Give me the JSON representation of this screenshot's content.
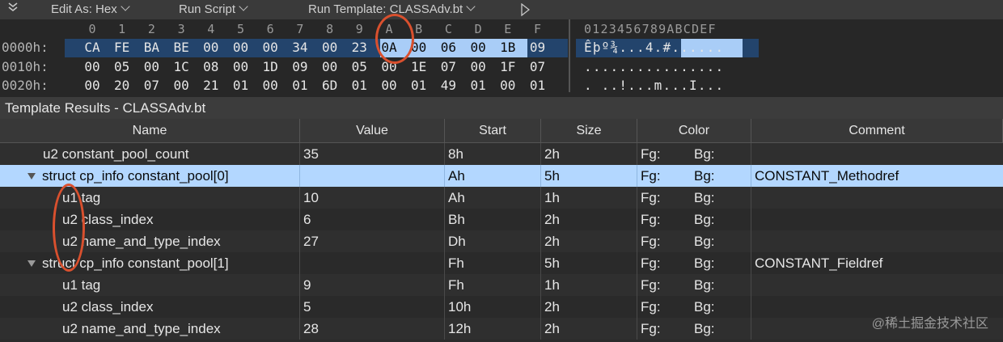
{
  "toolbar": {
    "items": [
      "Edit As: Hex",
      "Run Script",
      "Run Template: CLASSAdv.bt"
    ]
  },
  "hex": {
    "columns": [
      "0",
      "1",
      "2",
      "3",
      "4",
      "5",
      "6",
      "7",
      "8",
      "9",
      "A",
      "B",
      "C",
      "D",
      "E",
      "F"
    ],
    "ascii_header": "0123456789ABCDEF",
    "rows": [
      {
        "offset": "0000h:",
        "bytes": [
          "CA",
          "FE",
          "BA",
          "BE",
          "00",
          "00",
          "00",
          "34",
          "00",
          "23",
          "0A",
          "00",
          "06",
          "00",
          "1B",
          "09"
        ],
        "ascii": "Êþº¾...4.#......"
      },
      {
        "offset": "0010h:",
        "bytes": [
          "00",
          "05",
          "00",
          "1C",
          "08",
          "00",
          "1D",
          "09",
          "00",
          "05",
          "00",
          "1E",
          "07",
          "00",
          "1F",
          "07"
        ],
        "ascii": "................"
      },
      {
        "offset": "0020h:",
        "bytes": [
          "00",
          "20",
          "07",
          "00",
          "21",
          "01",
          "00",
          "01",
          "6D",
          "01",
          "00",
          "01",
          "49",
          "01",
          "00",
          "01"
        ],
        "ascii": ". ..!...m...I..."
      }
    ]
  },
  "results": {
    "title": "Template Results - CLASSAdv.bt",
    "columns": [
      "Name",
      "Value",
      "Start",
      "Size",
      "Color",
      "Comment"
    ],
    "fg_label": "Fg:",
    "bg_label": "Bg:",
    "rows": [
      {
        "name": "u2 constant_pool_count",
        "value": "35",
        "start": "8h",
        "size": "2h",
        "comment": "",
        "expanded": false,
        "indent": 0
      },
      {
        "name": "struct cp_info constant_pool[0]",
        "value": "",
        "start": "Ah",
        "size": "5h",
        "comment": "CONSTANT_Methodref",
        "expanded": true,
        "indent": 0,
        "selected": true
      },
      {
        "name": "u1 tag",
        "value": "10",
        "start": "Ah",
        "size": "1h",
        "comment": "",
        "indent": 1
      },
      {
        "name": "u2 class_index",
        "value": "6",
        "start": "Bh",
        "size": "2h",
        "comment": "",
        "indent": 1
      },
      {
        "name": "u2 name_and_type_index",
        "value": "27",
        "start": "Dh",
        "size": "2h",
        "comment": "",
        "indent": 1
      },
      {
        "name": "struct cp_info constant_pool[1]",
        "value": "",
        "start": "Fh",
        "size": "5h",
        "comment": "CONSTANT_Fieldref",
        "expanded": true,
        "indent": 0
      },
      {
        "name": "u1 tag",
        "value": "9",
        "start": "Fh",
        "size": "1h",
        "comment": "",
        "indent": 1
      },
      {
        "name": "u2 class_index",
        "value": "5",
        "start": "10h",
        "size": "2h",
        "comment": "",
        "indent": 1
      },
      {
        "name": "u2 name_and_type_index",
        "value": "28",
        "start": "12h",
        "size": "2h",
        "comment": "",
        "indent": 1
      }
    ]
  },
  "watermark": "@稀土掘金技术社区",
  "colors": {
    "highlight_circle": "#d9502e",
    "selection": "#b3d7ff",
    "dark_selection": "#23446c"
  }
}
